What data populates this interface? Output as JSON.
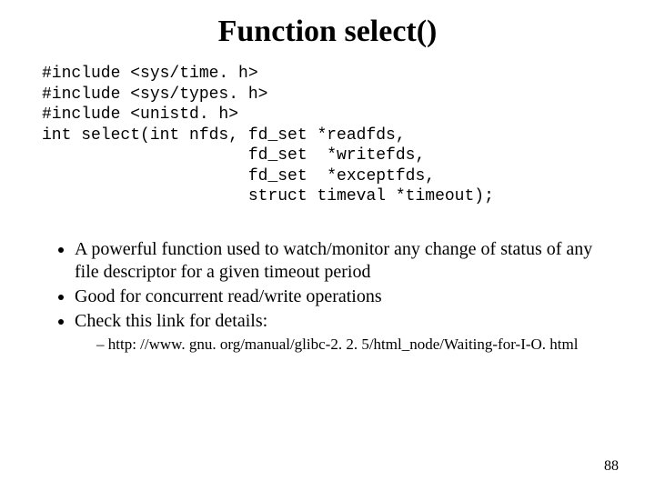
{
  "title": "Function select()",
  "code": "#include <sys/time. h>\n#include <sys/types. h>\n#include <unistd. h>\nint select(int nfds, fd_set *readfds,\n                     fd_set  *writefds,\n                     fd_set  *exceptfds,\n                     struct timeval *timeout);",
  "bullets": [
    "A powerful function used to watch/monitor any change of status of any file descriptor for a given timeout period",
    "Good for concurrent read/write operations",
    "Check this link for details:"
  ],
  "sub_bullet": "http: //www. gnu. org/manual/glibc-2. 2. 5/html_node/Waiting-for-I-O. html",
  "page_number": "88"
}
